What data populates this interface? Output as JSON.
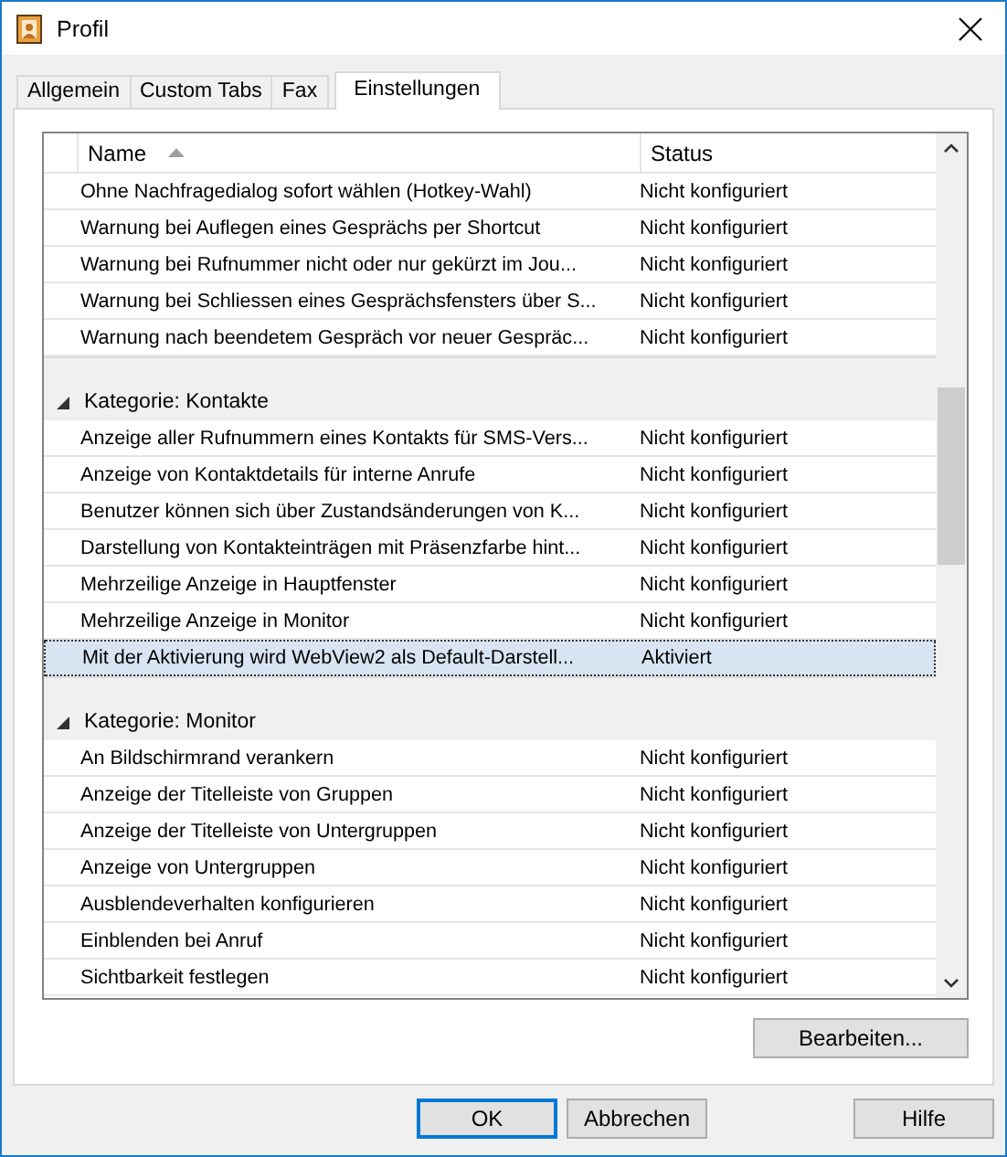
{
  "window": {
    "title": "Profil"
  },
  "tabs": [
    {
      "label": "Allgemein",
      "selected": false
    },
    {
      "label": "Custom Tabs",
      "selected": false
    },
    {
      "label": "Fax",
      "selected": false
    },
    {
      "label": "Einstellungen",
      "selected": true
    }
  ],
  "table": {
    "columns": [
      "Name",
      "Status"
    ],
    "groups": [
      {
        "rows": [
          {
            "name": "Ohne Nachfragedialog sofort wählen (Hotkey-Wahl)",
            "status": "Nicht konfiguriert",
            "selected": false
          },
          {
            "name": "Warnung bei Auflegen eines Gesprächs per Shortcut",
            "status": "Nicht konfiguriert",
            "selected": false
          },
          {
            "name": "Warnung bei Rufnummer nicht oder nur gekürzt im Jou...",
            "status": "Nicht konfiguriert",
            "selected": false
          },
          {
            "name": "Warnung bei Schliessen eines Gesprächsfensters über S...",
            "status": "Nicht konfiguriert",
            "selected": false
          },
          {
            "name": "Warnung nach beendetem Gespräch vor neuer Gespräc...",
            "status": "Nicht konfiguriert",
            "selected": false
          }
        ]
      },
      {
        "category": "Kategorie: Kontakte",
        "expanded": true,
        "rows": [
          {
            "name": "Anzeige aller Rufnummern eines Kontakts für SMS-Vers...",
            "status": "Nicht konfiguriert",
            "selected": false
          },
          {
            "name": "Anzeige von Kontaktdetails für interne Anrufe",
            "status": "Nicht konfiguriert",
            "selected": false
          },
          {
            "name": "Benutzer können sich über Zustandsänderungen von K...",
            "status": "Nicht konfiguriert",
            "selected": false
          },
          {
            "name": "Darstellung von Kontakteinträgen mit Präsenzfarbe hint...",
            "status": "Nicht konfiguriert",
            "selected": false
          },
          {
            "name": "Mehrzeilige Anzeige in Hauptfenster",
            "status": "Nicht konfiguriert",
            "selected": false
          },
          {
            "name": "Mehrzeilige Anzeige in Monitor",
            "status": "Nicht konfiguriert",
            "selected": false
          },
          {
            "name": "Mit der Aktivierung wird WebView2 als Default-Darstell...",
            "status": "Aktiviert",
            "selected": true
          }
        ]
      },
      {
        "category": "Kategorie: Monitor",
        "expanded": true,
        "rows": [
          {
            "name": "An Bildschirmrand verankern",
            "status": "Nicht konfiguriert",
            "selected": false
          },
          {
            "name": "Anzeige der Titelleiste von Gruppen",
            "status": "Nicht konfiguriert",
            "selected": false
          },
          {
            "name": "Anzeige der Titelleiste von Untergruppen",
            "status": "Nicht konfiguriert",
            "selected": false
          },
          {
            "name": "Anzeige von Untergruppen",
            "status": "Nicht konfiguriert",
            "selected": false
          },
          {
            "name": "Ausblendeverhalten konfigurieren",
            "status": "Nicht konfiguriert",
            "selected": false
          },
          {
            "name": "Einblenden bei Anruf",
            "status": "Nicht konfiguriert",
            "selected": false
          },
          {
            "name": "Sichtbarkeit festlegen",
            "status": "Nicht konfiguriert",
            "selected": false
          }
        ]
      }
    ]
  },
  "edit_button": "Bearbeiten...",
  "buttons": [
    {
      "label": "OK",
      "kind": "default"
    },
    {
      "label": "Abbrechen",
      "kind": "normal"
    },
    {
      "label": "Hilfe",
      "kind": "help"
    }
  ]
}
